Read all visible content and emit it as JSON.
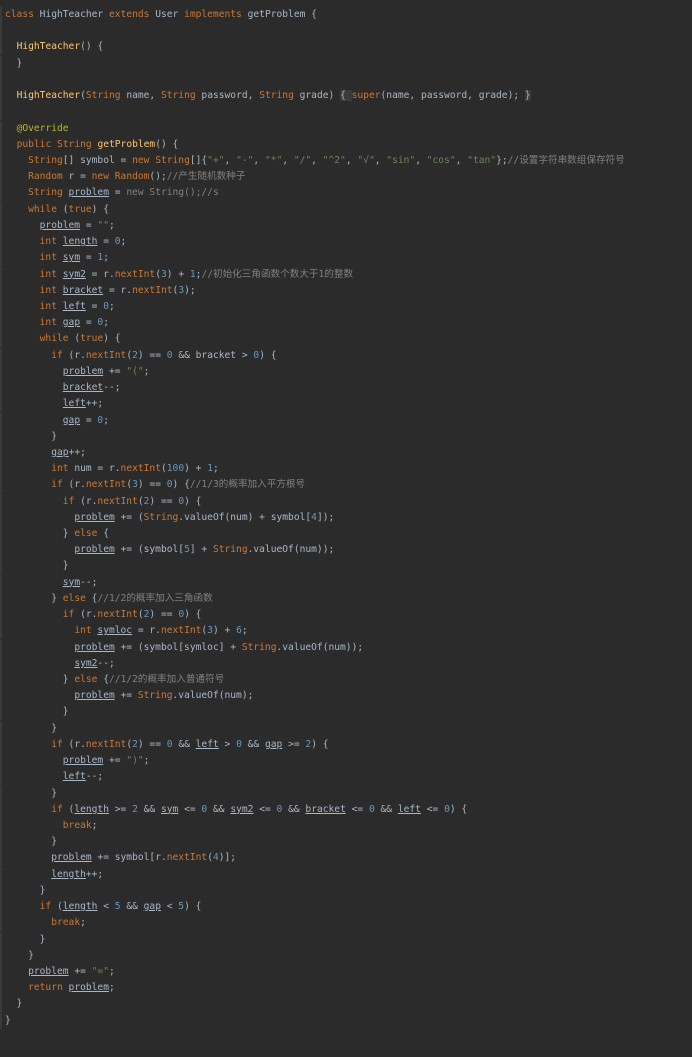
{
  "lines": [
    [
      {
        "t": "class ",
        "c": "kw"
      },
      {
        "t": "HighTeacher ",
        "c": "var"
      },
      {
        "t": "extends ",
        "c": "kw"
      },
      {
        "t": "User ",
        "c": "var"
      },
      {
        "t": "implements ",
        "c": "kw"
      },
      {
        "t": "getProblem {",
        "c": "var"
      }
    ],
    [],
    [
      {
        "t": "  "
      },
      {
        "t": "HighTeacher",
        "c": "fn"
      },
      {
        "t": "() {"
      }
    ],
    [
      {
        "t": "  }"
      }
    ],
    [],
    [
      {
        "t": "  "
      },
      {
        "t": "HighTeacher",
        "c": "fn"
      },
      {
        "t": "("
      },
      {
        "t": "String ",
        "c": "kw"
      },
      {
        "t": "name, "
      },
      {
        "t": "String ",
        "c": "kw"
      },
      {
        "t": "password, "
      },
      {
        "t": "String ",
        "c": "kw"
      },
      {
        "t": "grade) "
      },
      {
        "t": "{ ",
        "c": "hl"
      },
      {
        "t": "super",
        "c": "kw"
      },
      {
        "t": "(name, password, grade); "
      },
      {
        "t": "}",
        "c": "hl"
      }
    ],
    [],
    [
      {
        "t": "  "
      },
      {
        "t": "@Override",
        "c": "ann"
      }
    ],
    [
      {
        "t": "  "
      },
      {
        "t": "public ",
        "c": "kw"
      },
      {
        "t": "String ",
        "c": "kw"
      },
      {
        "t": "getProblem",
        "c": "fn"
      },
      {
        "t": "() {"
      }
    ],
    [
      {
        "t": "    "
      },
      {
        "t": "String",
        "c": "kw"
      },
      {
        "t": "[] symbol = "
      },
      {
        "t": "new ",
        "c": "kw"
      },
      {
        "t": "String",
        "c": "kw"
      },
      {
        "t": "[]{"
      },
      {
        "t": "\"+\"",
        "c": "str"
      },
      {
        "t": ", "
      },
      {
        "t": "\"-\"",
        "c": "str"
      },
      {
        "t": ", "
      },
      {
        "t": "\"*\"",
        "c": "str"
      },
      {
        "t": ", "
      },
      {
        "t": "\"/\"",
        "c": "str"
      },
      {
        "t": ", "
      },
      {
        "t": "\"^2\"",
        "c": "str"
      },
      {
        "t": ", "
      },
      {
        "t": "\"√\"",
        "c": "str"
      },
      {
        "t": ", "
      },
      {
        "t": "\"sin\"",
        "c": "str"
      },
      {
        "t": ", "
      },
      {
        "t": "\"cos\"",
        "c": "str"
      },
      {
        "t": ", "
      },
      {
        "t": "\"tan\"",
        "c": "str"
      },
      {
        "t": "};"
      },
      {
        "t": "//设置字符串数组保存符号",
        "c": "cmt"
      }
    ],
    [
      {
        "t": "    "
      },
      {
        "t": "Random ",
        "c": "kw"
      },
      {
        "t": "r = "
      },
      {
        "t": "new ",
        "c": "kw"
      },
      {
        "t": "Random",
        "c": "kw"
      },
      {
        "t": "();"
      },
      {
        "t": "//产生随机数种子",
        "c": "cmt"
      }
    ],
    [
      {
        "t": "    "
      },
      {
        "t": "String ",
        "c": "kw"
      },
      {
        "t": "problem",
        "c": "u"
      },
      {
        "t": " = "
      },
      {
        "t": "new String();//s",
        "c": "cmt"
      }
    ],
    [
      {
        "t": "    "
      },
      {
        "t": "while ",
        "c": "kw"
      },
      {
        "t": "("
      },
      {
        "t": "true",
        "c": "kw"
      },
      {
        "t": ") {"
      }
    ],
    [
      {
        "t": "      "
      },
      {
        "t": "problem",
        "c": "u"
      },
      {
        "t": " = "
      },
      {
        "t": "\"\"",
        "c": "str"
      },
      {
        "t": ";"
      }
    ],
    [
      {
        "t": "      "
      },
      {
        "t": "int ",
        "c": "kw"
      },
      {
        "t": "length",
        "c": "u"
      },
      {
        "t": " = "
      },
      {
        "t": "0",
        "c": "num"
      },
      {
        "t": ";"
      }
    ],
    [
      {
        "t": "      "
      },
      {
        "t": "int ",
        "c": "kw"
      },
      {
        "t": "sym",
        "c": "u"
      },
      {
        "t": " = "
      },
      {
        "t": "1",
        "c": "num"
      },
      {
        "t": ";"
      }
    ],
    [
      {
        "t": "      "
      },
      {
        "t": "int ",
        "c": "kw"
      },
      {
        "t": "sym2",
        "c": "u"
      },
      {
        "t": " = r."
      },
      {
        "t": "nextInt",
        "c": "kw"
      },
      {
        "t": "("
      },
      {
        "t": "3",
        "c": "num"
      },
      {
        "t": ") + "
      },
      {
        "t": "1",
        "c": "num"
      },
      {
        "t": ";"
      },
      {
        "t": "//初始化三角函数个数大于1的整数",
        "c": "cmt"
      }
    ],
    [
      {
        "t": "      "
      },
      {
        "t": "int ",
        "c": "kw"
      },
      {
        "t": "bracket",
        "c": "u"
      },
      {
        "t": " = r."
      },
      {
        "t": "nextInt",
        "c": "kw"
      },
      {
        "t": "("
      },
      {
        "t": "3",
        "c": "num"
      },
      {
        "t": ");"
      }
    ],
    [
      {
        "t": "      "
      },
      {
        "t": "int ",
        "c": "kw"
      },
      {
        "t": "left",
        "c": "u"
      },
      {
        "t": " = "
      },
      {
        "t": "0",
        "c": "num"
      },
      {
        "t": ";"
      }
    ],
    [
      {
        "t": "      "
      },
      {
        "t": "int ",
        "c": "kw"
      },
      {
        "t": "gap",
        "c": "u"
      },
      {
        "t": " = "
      },
      {
        "t": "0",
        "c": "num"
      },
      {
        "t": ";"
      }
    ],
    [
      {
        "t": "      "
      },
      {
        "t": "while ",
        "c": "kw"
      },
      {
        "t": "("
      },
      {
        "t": "true",
        "c": "kw"
      },
      {
        "t": ") {"
      }
    ],
    [
      {
        "t": "        "
      },
      {
        "t": "if ",
        "c": "kw"
      },
      {
        "t": "(r."
      },
      {
        "t": "nextInt",
        "c": "kw"
      },
      {
        "t": "("
      },
      {
        "t": "2",
        "c": "num"
      },
      {
        "t": ") == "
      },
      {
        "t": "0 ",
        "c": "num"
      },
      {
        "t": "&& bracket > "
      },
      {
        "t": "0",
        "c": "num"
      },
      {
        "t": ") {"
      }
    ],
    [
      {
        "t": "          "
      },
      {
        "t": "problem",
        "c": "u"
      },
      {
        "t": " += "
      },
      {
        "t": "\"(\"",
        "c": "str"
      },
      {
        "t": ";"
      }
    ],
    [
      {
        "t": "          "
      },
      {
        "t": "bracket",
        "c": "u"
      },
      {
        "t": "--;"
      }
    ],
    [
      {
        "t": "          "
      },
      {
        "t": "left",
        "c": "u"
      },
      {
        "t": "++;"
      }
    ],
    [
      {
        "t": "          "
      },
      {
        "t": "gap",
        "c": "u"
      },
      {
        "t": " = "
      },
      {
        "t": "0",
        "c": "num"
      },
      {
        "t": ";"
      }
    ],
    [
      {
        "t": "        }"
      }
    ],
    [
      {
        "t": "        "
      },
      {
        "t": "gap",
        "c": "u"
      },
      {
        "t": "++;"
      }
    ],
    [
      {
        "t": "        "
      },
      {
        "t": "int ",
        "c": "kw"
      },
      {
        "t": "num = r."
      },
      {
        "t": "nextInt",
        "c": "kw"
      },
      {
        "t": "("
      },
      {
        "t": "100",
        "c": "num"
      },
      {
        "t": ") + "
      },
      {
        "t": "1",
        "c": "num"
      },
      {
        "t": ";"
      }
    ],
    [
      {
        "t": "        "
      },
      {
        "t": "if ",
        "c": "kw"
      },
      {
        "t": "(r."
      },
      {
        "t": "nextInt",
        "c": "kw"
      },
      {
        "t": "("
      },
      {
        "t": "3",
        "c": "num"
      },
      {
        "t": ") == "
      },
      {
        "t": "0",
        "c": "num"
      },
      {
        "t": ") {"
      },
      {
        "t": "//1/3的概率加入平方根号",
        "c": "cmt"
      }
    ],
    [
      {
        "t": "          "
      },
      {
        "t": "if ",
        "c": "kw"
      },
      {
        "t": "(r."
      },
      {
        "t": "nextInt",
        "c": "kw"
      },
      {
        "t": "("
      },
      {
        "t": "2",
        "c": "num"
      },
      {
        "t": ") == "
      },
      {
        "t": "0",
        "c": "num"
      },
      {
        "t": ") {"
      }
    ],
    [
      {
        "t": "            "
      },
      {
        "t": "problem",
        "c": "u"
      },
      {
        "t": " += ("
      },
      {
        "t": "String",
        "c": "kw"
      },
      {
        "t": ".valueOf(num) + symbol["
      },
      {
        "t": "4",
        "c": "num"
      },
      {
        "t": "]);"
      }
    ],
    [
      {
        "t": "          } "
      },
      {
        "t": "else ",
        "c": "kw"
      },
      {
        "t": "{"
      }
    ],
    [
      {
        "t": "            "
      },
      {
        "t": "problem",
        "c": "u"
      },
      {
        "t": " += (symbol["
      },
      {
        "t": "5",
        "c": "num"
      },
      {
        "t": "] + "
      },
      {
        "t": "String",
        "c": "kw"
      },
      {
        "t": ".valueOf(num));"
      }
    ],
    [
      {
        "t": "          }"
      }
    ],
    [
      {
        "t": "          "
      },
      {
        "t": "sym",
        "c": "u"
      },
      {
        "t": "--;"
      }
    ],
    [
      {
        "t": "        } "
      },
      {
        "t": "else ",
        "c": "kw"
      },
      {
        "t": "{"
      },
      {
        "t": "//1/2的概率加入三角函数",
        "c": "cmt"
      }
    ],
    [
      {
        "t": "          "
      },
      {
        "t": "if ",
        "c": "kw"
      },
      {
        "t": "(r."
      },
      {
        "t": "nextInt",
        "c": "kw"
      },
      {
        "t": "("
      },
      {
        "t": "2",
        "c": "num"
      },
      {
        "t": ") == "
      },
      {
        "t": "0",
        "c": "num"
      },
      {
        "t": ") {"
      }
    ],
    [
      {
        "t": "            "
      },
      {
        "t": "int ",
        "c": "kw"
      },
      {
        "t": "symloc",
        "c": "u"
      },
      {
        "t": " = r."
      },
      {
        "t": "nextInt",
        "c": "kw"
      },
      {
        "t": "("
      },
      {
        "t": "3",
        "c": "num"
      },
      {
        "t": ") + "
      },
      {
        "t": "6",
        "c": "num"
      },
      {
        "t": ";"
      }
    ],
    [
      {
        "t": "            "
      },
      {
        "t": "problem",
        "c": "u"
      },
      {
        "t": " += (symbol[symloc] + "
      },
      {
        "t": "String",
        "c": "kw"
      },
      {
        "t": ".valueOf(num));"
      }
    ],
    [
      {
        "t": "            "
      },
      {
        "t": "sym2",
        "c": "u"
      },
      {
        "t": "--;"
      }
    ],
    [
      {
        "t": "          } "
      },
      {
        "t": "else ",
        "c": "kw"
      },
      {
        "t": "{"
      },
      {
        "t": "//1/2的概率加入普通符号",
        "c": "cmt"
      }
    ],
    [
      {
        "t": "            "
      },
      {
        "t": "problem",
        "c": "u"
      },
      {
        "t": " += "
      },
      {
        "t": "String",
        "c": "kw"
      },
      {
        "t": ".valueOf(num);"
      }
    ],
    [
      {
        "t": "          }"
      }
    ],
    [
      {
        "t": "        }"
      }
    ],
    [
      {
        "t": "        "
      },
      {
        "t": "if ",
        "c": "kw"
      },
      {
        "t": "(r."
      },
      {
        "t": "nextInt",
        "c": "kw"
      },
      {
        "t": "("
      },
      {
        "t": "2",
        "c": "num"
      },
      {
        "t": ") == "
      },
      {
        "t": "0 ",
        "c": "num"
      },
      {
        "t": "&& "
      },
      {
        "t": "left",
        "c": "u"
      },
      {
        "t": " > "
      },
      {
        "t": "0 ",
        "c": "num"
      },
      {
        "t": "&& "
      },
      {
        "t": "gap",
        "c": "u"
      },
      {
        "t": " >= "
      },
      {
        "t": "2",
        "c": "num"
      },
      {
        "t": ") {"
      }
    ],
    [
      {
        "t": "          "
      },
      {
        "t": "problem",
        "c": "u"
      },
      {
        "t": " += "
      },
      {
        "t": "\")\"",
        "c": "str"
      },
      {
        "t": ";"
      }
    ],
    [
      {
        "t": "          "
      },
      {
        "t": "left",
        "c": "u"
      },
      {
        "t": "--;"
      }
    ],
    [
      {
        "t": "        }"
      }
    ],
    [
      {
        "t": "        "
      },
      {
        "t": "if ",
        "c": "kw"
      },
      {
        "t": "("
      },
      {
        "t": "length",
        "c": "u"
      },
      {
        "t": " >= "
      },
      {
        "t": "2 ",
        "c": "num"
      },
      {
        "t": "&& "
      },
      {
        "t": "sym",
        "c": "u"
      },
      {
        "t": " <= "
      },
      {
        "t": "0 ",
        "c": "num"
      },
      {
        "t": "&& "
      },
      {
        "t": "sym2",
        "c": "u"
      },
      {
        "t": " <= "
      },
      {
        "t": "0 ",
        "c": "num"
      },
      {
        "t": "&& "
      },
      {
        "t": "bracket",
        "c": "u"
      },
      {
        "t": " <= "
      },
      {
        "t": "0 ",
        "c": "num"
      },
      {
        "t": "&& "
      },
      {
        "t": "left",
        "c": "u"
      },
      {
        "t": " <= "
      },
      {
        "t": "0",
        "c": "num"
      },
      {
        "t": ") {"
      }
    ],
    [
      {
        "t": "          "
      },
      {
        "t": "break",
        "c": "kw"
      },
      {
        "t": ";"
      }
    ],
    [
      {
        "t": "        }"
      }
    ],
    [
      {
        "t": "        "
      },
      {
        "t": "problem",
        "c": "u"
      },
      {
        "t": " += symbol[r."
      },
      {
        "t": "nextInt",
        "c": "kw"
      },
      {
        "t": "("
      },
      {
        "t": "4",
        "c": "num"
      },
      {
        "t": ")];"
      }
    ],
    [
      {
        "t": "        "
      },
      {
        "t": "length",
        "c": "u"
      },
      {
        "t": "++;"
      }
    ],
    [
      {
        "t": "      }"
      }
    ],
    [
      {
        "t": "      "
      },
      {
        "t": "if ",
        "c": "kw"
      },
      {
        "t": "("
      },
      {
        "t": "length",
        "c": "u"
      },
      {
        "t": " < "
      },
      {
        "t": "5 ",
        "c": "num"
      },
      {
        "t": "&& "
      },
      {
        "t": "gap",
        "c": "u"
      },
      {
        "t": " < "
      },
      {
        "t": "5",
        "c": "num"
      },
      {
        "t": ") {"
      }
    ],
    [
      {
        "t": "        "
      },
      {
        "t": "break",
        "c": "kw"
      },
      {
        "t": ";"
      }
    ],
    [
      {
        "t": "      }"
      }
    ],
    [
      {
        "t": "    }"
      }
    ],
    [
      {
        "t": "    "
      },
      {
        "t": "problem",
        "c": "u"
      },
      {
        "t": " += "
      },
      {
        "t": "\"=\"",
        "c": "str"
      },
      {
        "t": ";"
      }
    ],
    [
      {
        "t": "    "
      },
      {
        "t": "return ",
        "c": "kw"
      },
      {
        "t": "problem",
        "c": "u"
      },
      {
        "t": ";"
      }
    ],
    [
      {
        "t": "  }"
      }
    ],
    [
      {
        "t": "}"
      }
    ]
  ]
}
